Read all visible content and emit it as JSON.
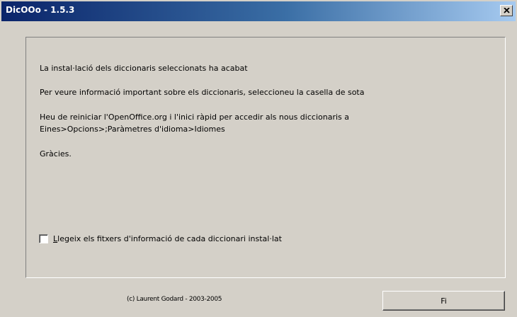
{
  "window": {
    "title": "DicOOo - 1.5.3",
    "close_icon": "close-x-icon"
  },
  "message": {
    "line1": "La instal·lació dels diccionaris seleccionats ha acabat",
    "line2": "Per veure informació important sobre els diccionaris, seleccioneu la casella de sota",
    "line3a": "Heu de reiniciar l'OpenOffice.org i l'inici ràpid per accedir als nous diccionaris a",
    "line3b": "Eines>Opcions>;Paràmetres d'idioma>Idiomes",
    "line4": "Gràcies."
  },
  "checkbox": {
    "label_first": "L",
    "label_rest": "legeix els fitxers d'informació de cada diccionari instal·lat",
    "checked": false
  },
  "footer": {
    "copyright": "(c) Laurent Godard - 2003-2005",
    "finish_label": "Fi"
  },
  "colors": {
    "face": "#d4d0c8",
    "title_start": "#0a246a",
    "title_end": "#a6caf0"
  }
}
